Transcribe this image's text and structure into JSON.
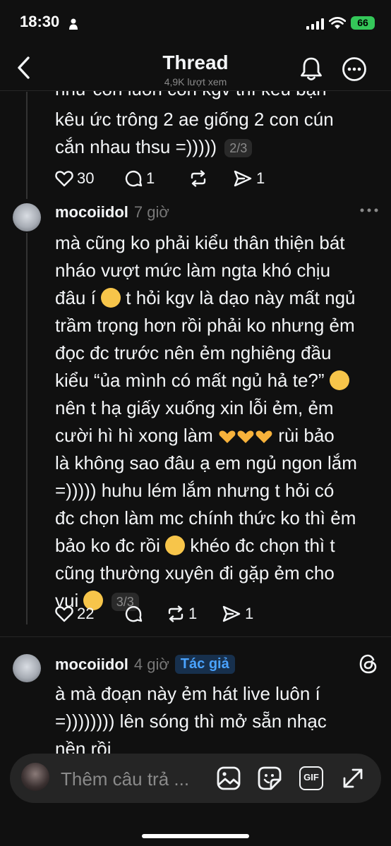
{
  "status_bar": {
    "time": "18:30",
    "battery": "66"
  },
  "header": {
    "title": "Thread",
    "views": "4,9K lượt xem"
  },
  "post1": {
    "clipped_line": "như con luôn còn kgv thì kêu bạn",
    "lines": [
      "kêu ức trông 2 ae giống 2 con cún",
      "cắn nhau thsu =)))))"
    ],
    "page": "2/3",
    "likes": "30",
    "comments": "1",
    "reposts": "",
    "shares": "1"
  },
  "post2": {
    "username": "mocoiidol",
    "time": "7 giờ",
    "lines": [
      "mà cũng ko phải kiểu thân thiện bát",
      "nháo vượt mức làm ngta khó chịu",
      "đâu í",
      "t hỏi kgv là dạo này mất ngủ",
      "trầm trọng hơn rồi phải ko nhưng ẻm",
      "đọc đc trước nên ẻm nghiêng đầu",
      "kiểu “ủa mình có mất ngủ hả te?”",
      "nên t hạ giấy xuống xin lỗi ẻm, ẻm",
      "cười hì hì xong làm",
      "rùi bảo",
      "là không sao đâu ạ em ngủ ngon lắm",
      "=))))) huhu lém lắm nhưng t hỏi có",
      "đc chọn làm mc chính thức ko thì ẻm",
      "bảo ko đc rồi",
      "khéo đc chọn thì t",
      "cũng thường xuyên đi gặp ẻm cho",
      "vui"
    ],
    "page": "3/3",
    "likes": "22",
    "comments": "",
    "reposts": "1",
    "shares": "1"
  },
  "post3": {
    "username": "mocoiidol",
    "time": "4 giờ",
    "badge": "Tác giả",
    "lines": [
      "à mà đoạn này ẻm hát live luôn í",
      "=)))))))) lên sóng thì mở sẵn nhạc",
      "nền rồi"
    ]
  },
  "reply_bar": {
    "placeholder": "Thêm câu trả ...",
    "gif_label": "GIF"
  },
  "colors": {
    "background": "#101010",
    "author_badge_text": "#4aa3ff",
    "battery": "#34c759"
  },
  "icons": [
    "back-chevron-icon",
    "bell-icon",
    "more-circle-icon",
    "heart-icon",
    "comment-icon",
    "repost-icon",
    "share-icon",
    "threads-logo-icon",
    "image-icon",
    "sticker-icon",
    "gif-icon",
    "expand-icon"
  ]
}
